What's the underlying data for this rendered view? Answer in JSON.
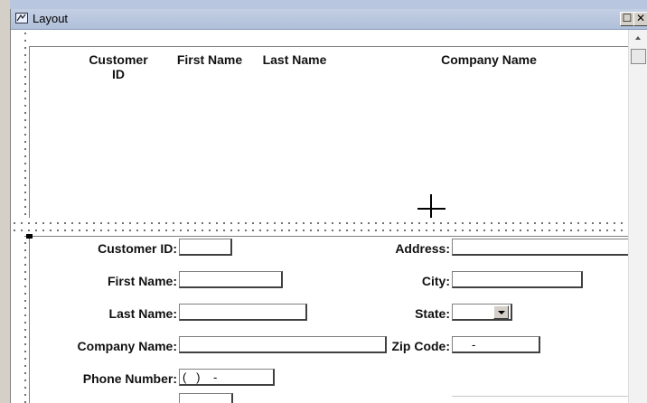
{
  "window": {
    "title": "Layout",
    "maximize_glyph": "☐",
    "close_glyph": "✕"
  },
  "header_section": {
    "columns": [
      {
        "label": "Customer\nID"
      },
      {
        "label": "First Name"
      },
      {
        "label": "Last Name"
      },
      {
        "label": "Company Name"
      }
    ]
  },
  "detail_section": {
    "left_fields": [
      {
        "label": "Customer ID:",
        "value": ""
      },
      {
        "label": "First Name:",
        "value": ""
      },
      {
        "label": "Last Name:",
        "value": ""
      },
      {
        "label": "Company Name:",
        "value": ""
      },
      {
        "label": "Phone Number:",
        "value": "(   )    -"
      }
    ],
    "right_fields": [
      {
        "label": "Address:",
        "value": ""
      },
      {
        "label": "City:",
        "value": ""
      },
      {
        "label": "State:",
        "value": ""
      },
      {
        "label": "Zip Code:",
        "value": "     -"
      }
    ]
  }
}
